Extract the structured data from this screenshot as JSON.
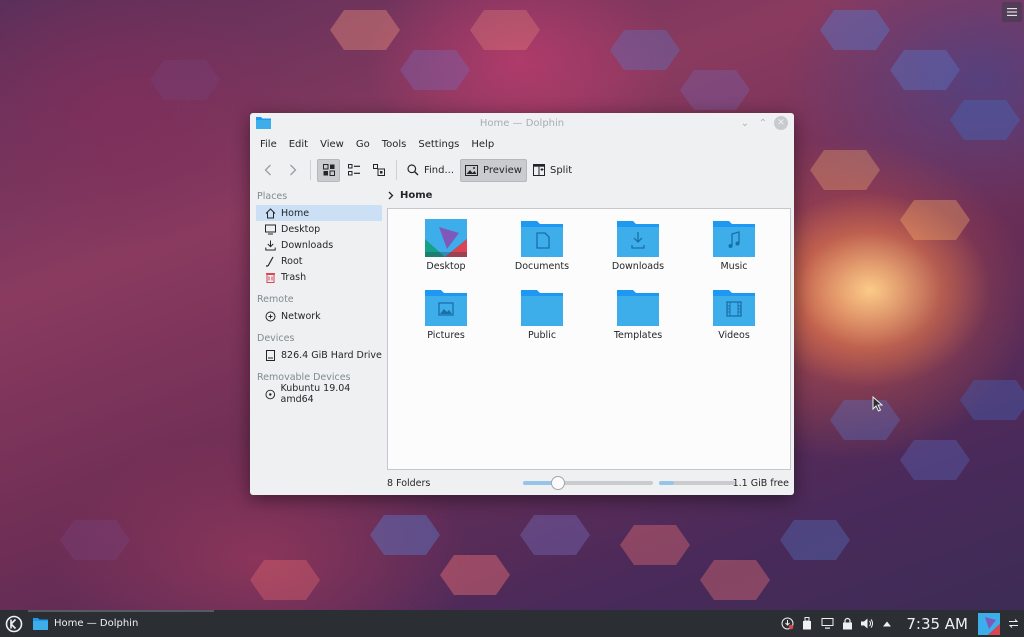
{
  "window": {
    "title": "Home — Dolphin",
    "controls": {
      "minimize": "⌄",
      "maximize": "⌃",
      "close": "✕"
    }
  },
  "menubar": [
    "File",
    "Edit",
    "View",
    "Go",
    "Tools",
    "Settings",
    "Help"
  ],
  "toolbar": {
    "find_label": "Find...",
    "preview_label": "Preview",
    "split_label": "Split"
  },
  "sidebar": {
    "places_header": "Places",
    "places": [
      {
        "label": "Home",
        "icon": "home-icon"
      },
      {
        "label": "Desktop",
        "icon": "desktop-icon"
      },
      {
        "label": "Downloads",
        "icon": "download-icon"
      },
      {
        "label": "Root",
        "icon": "root-icon"
      },
      {
        "label": "Trash",
        "icon": "trash-icon"
      }
    ],
    "remote_header": "Remote",
    "remote": [
      {
        "label": "Network",
        "icon": "network-icon"
      }
    ],
    "devices_header": "Devices",
    "devices": [
      {
        "label": "826.4 GiB Hard Drive",
        "icon": "harddrive-icon"
      }
    ],
    "removable_header": "Removable Devices",
    "removable": [
      {
        "label": "Kubuntu 19.04 amd64",
        "icon": "optical-disc-icon"
      }
    ]
  },
  "breadcrumb": {
    "current": "Home"
  },
  "folders": [
    {
      "label": "Desktop",
      "icon": "desktop-folder-icon"
    },
    {
      "label": "Documents",
      "icon": "documents-folder-icon"
    },
    {
      "label": "Downloads",
      "icon": "downloads-folder-icon"
    },
    {
      "label": "Music",
      "icon": "music-folder-icon"
    },
    {
      "label": "Pictures",
      "icon": "pictures-folder-icon"
    },
    {
      "label": "Public",
      "icon": "public-folder-icon"
    },
    {
      "label": "Templates",
      "icon": "templates-folder-icon"
    },
    {
      "label": "Videos",
      "icon": "videos-folder-icon"
    }
  ],
  "statusbar": {
    "summary": "8 Folders",
    "zoom_level": 0.27,
    "space_used": 0.2,
    "free_space": "1.1 GiB free"
  },
  "taskbar": {
    "task_label": "Home — Dolphin",
    "clock": "7:35 AM"
  },
  "colors": {
    "accent": "#3daee9",
    "folder_blue": "#3daee9",
    "selection": "#cbe0f5",
    "panel": "#2b2f33"
  }
}
